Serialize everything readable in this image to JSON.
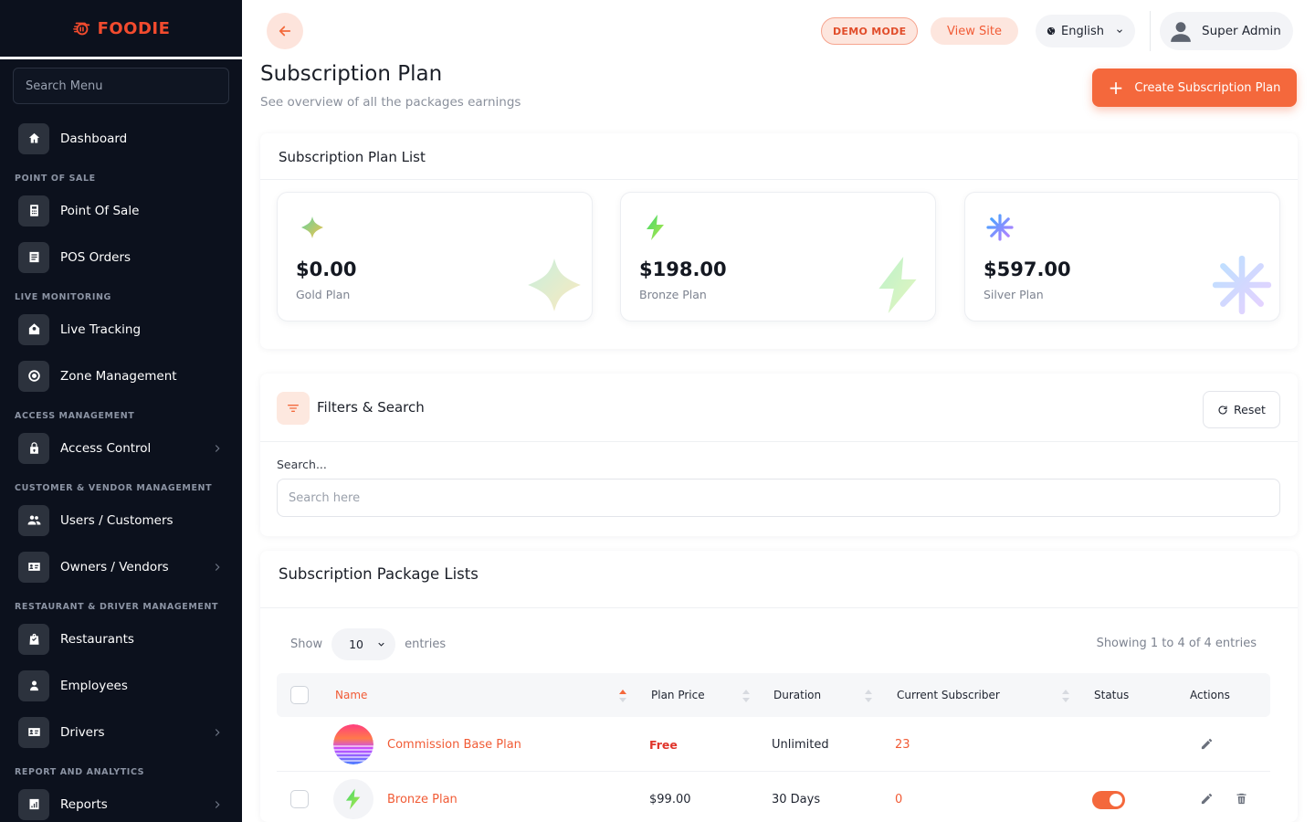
{
  "brand": {
    "name": "FOODIE",
    "accent": "#f24b2e"
  },
  "sidebar": {
    "search_placeholder": "Search Menu",
    "groups": [
      {
        "section": "",
        "items": [
          {
            "label": "Dashboard",
            "icon": "home-icon"
          }
        ]
      },
      {
        "section": "POINT OF SALE",
        "items": [
          {
            "label": "Point Of Sale",
            "icon": "calculator-icon"
          },
          {
            "label": "POS Orders",
            "icon": "list-icon"
          }
        ]
      },
      {
        "section": "LIVE MONITORING",
        "items": [
          {
            "label": "Live Tracking",
            "icon": "tracking-icon"
          },
          {
            "label": "Zone Management",
            "icon": "target-icon"
          }
        ]
      },
      {
        "section": "ACCESS MANAGEMENT",
        "items": [
          {
            "label": "Access Control",
            "icon": "lock-icon",
            "chevron": true
          }
        ]
      },
      {
        "section": "CUSTOMER & VENDOR MANAGEMENT",
        "items": [
          {
            "label": "Users / Customers",
            "icon": "users-icon"
          },
          {
            "label": "Owners / Vendors",
            "icon": "id-card-icon",
            "chevron": true
          }
        ]
      },
      {
        "section": "RESTAURANT & DRIVER MANAGEMENT",
        "items": [
          {
            "label": "Restaurants",
            "icon": "bag-icon"
          },
          {
            "label": "Employees",
            "icon": "person-icon"
          },
          {
            "label": "Drivers",
            "icon": "id-card-icon",
            "chevron": true
          }
        ]
      },
      {
        "section": "REPORT AND ANALYTICS",
        "items": [
          {
            "label": "Reports",
            "icon": "report-icon",
            "chevron": true
          }
        ]
      }
    ]
  },
  "topbar": {
    "demo_mode": "DEMO MODE",
    "view_site": "View Site",
    "language": "English",
    "user": "Super Admin"
  },
  "header": {
    "title": "Subscription Plan",
    "subtitle": "See overview of all the packages earnings",
    "create_button": "Create Subscription Plan"
  },
  "plan_list": {
    "title": "Subscription Plan List",
    "cards": [
      {
        "price": "$0.00",
        "name": "Gold Plan",
        "icon": "four-point-star-icon"
      },
      {
        "price": "$198.00",
        "name": "Bronze Plan",
        "icon": "lightning-icon"
      },
      {
        "price": "$597.00",
        "name": "Silver Plan",
        "icon": "asterisk-flower-icon"
      }
    ]
  },
  "filters": {
    "title": "Filters & Search",
    "reset": "Reset",
    "search_label": "Search...",
    "search_placeholder": "Search here"
  },
  "packages": {
    "title": "Subscription Package Lists",
    "show_label": "Show",
    "entries_label": "entries",
    "page_size": "10",
    "showing": "Showing 1 to 4 of 4 entries",
    "columns": [
      "Name",
      "Plan Price",
      "Duration",
      "Current Subscriber",
      "Status",
      "Actions"
    ],
    "rows": [
      {
        "name": "Commission Base Plan",
        "price": "Free",
        "duration": "Unlimited",
        "subscribers": "23",
        "status": null
      },
      {
        "name": "Bronze Plan",
        "price": "$99.00",
        "duration": "30 Days",
        "subscribers": "0",
        "status": true
      }
    ]
  }
}
